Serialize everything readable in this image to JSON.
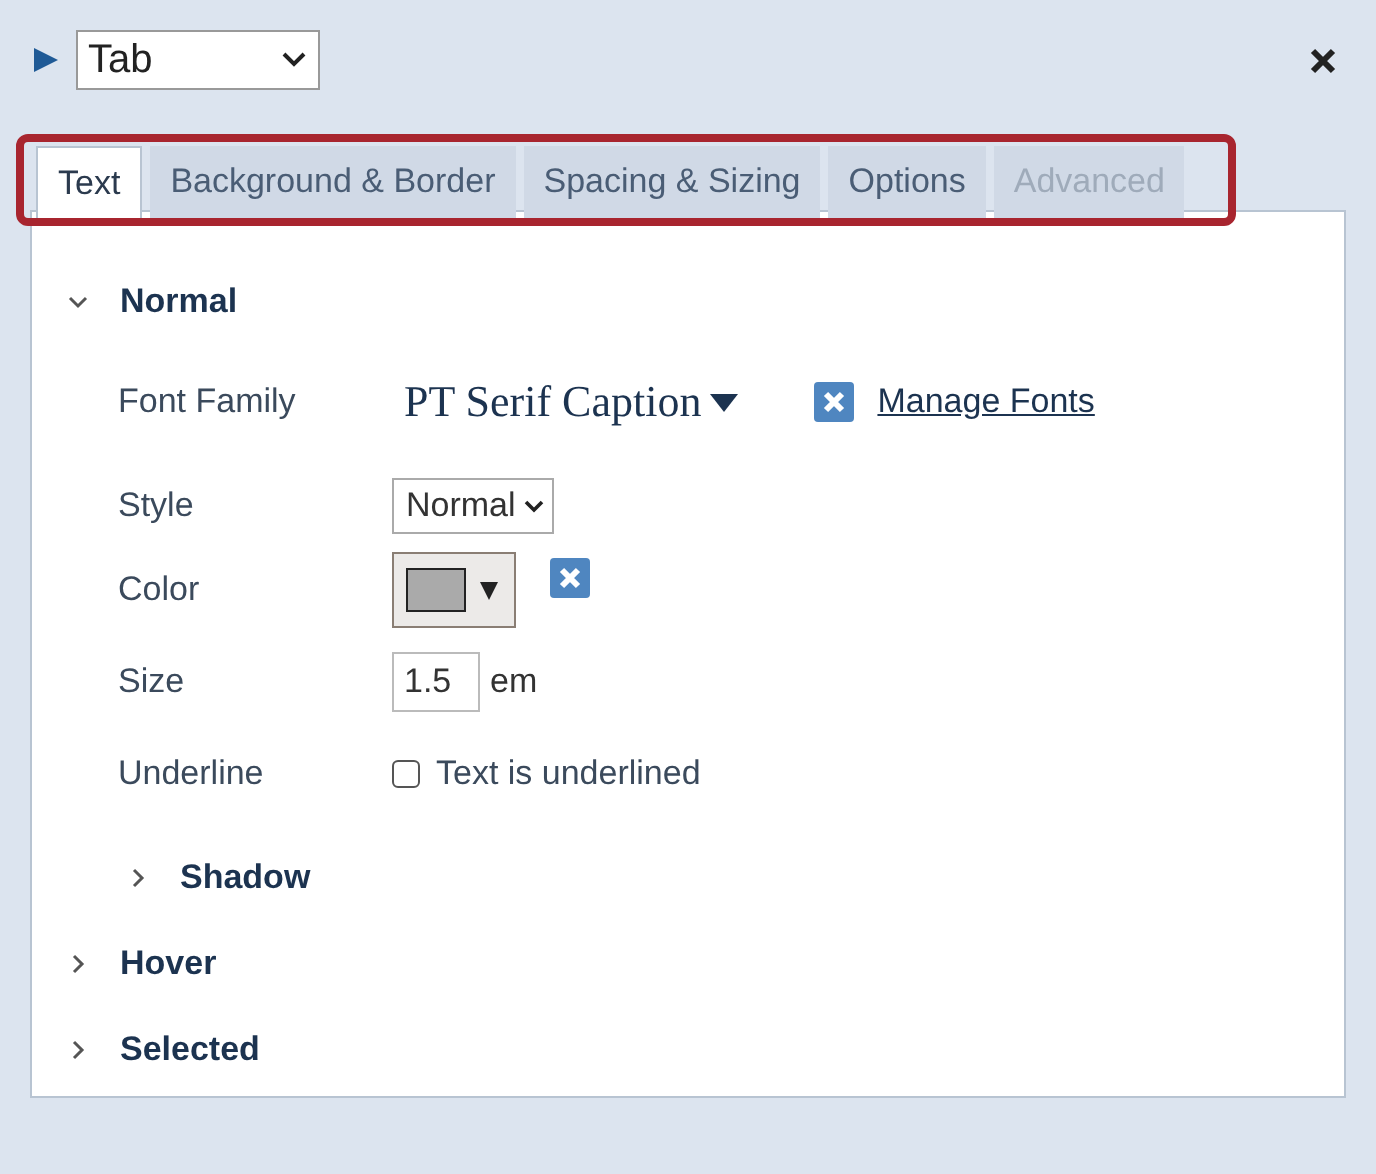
{
  "element_select": {
    "value": "Tab"
  },
  "tabs_highlighted": true,
  "tabs": [
    {
      "label": "Text",
      "selected": true,
      "disabled": false
    },
    {
      "label": "Background & Border",
      "selected": false,
      "disabled": false
    },
    {
      "label": "Spacing & Sizing",
      "selected": false,
      "disabled": false
    },
    {
      "label": "Options",
      "selected": false,
      "disabled": false
    },
    {
      "label": "Advanced",
      "selected": false,
      "disabled": true
    }
  ],
  "sections": [
    {
      "title": "Normal",
      "expanded": true,
      "fields": [
        {
          "kind": "font",
          "label": "Font Family",
          "value": "PT Serif Caption",
          "link": "Manage Fonts"
        },
        {
          "kind": "select",
          "label": "Style",
          "value": "Normal"
        },
        {
          "kind": "color",
          "label": "Color",
          "color": "#aaaaaa"
        },
        {
          "kind": "number",
          "label": "Size",
          "value": "1.5",
          "unit": "em"
        },
        {
          "kind": "checkbox",
          "label": "Underline",
          "checked": false,
          "text": "Text is underlined"
        }
      ],
      "subsections": [
        {
          "title": "Shadow",
          "expanded": false
        }
      ]
    },
    {
      "title": "Hover",
      "expanded": false
    },
    {
      "title": "Selected",
      "expanded": false
    }
  ]
}
